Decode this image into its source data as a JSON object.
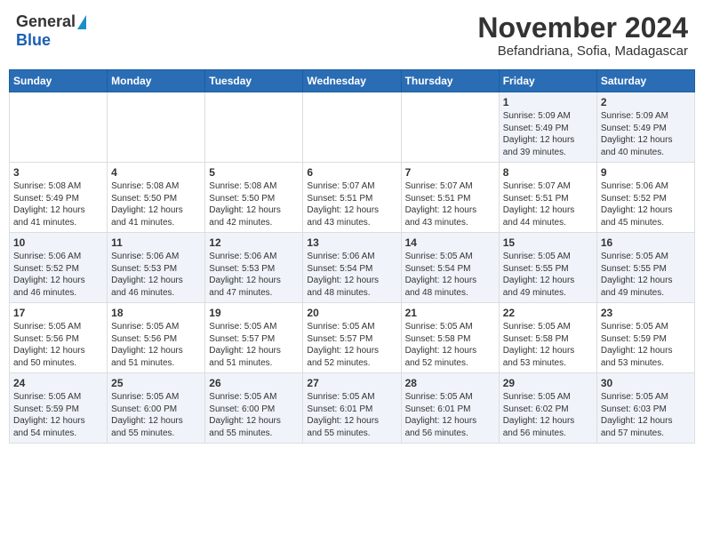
{
  "logo": {
    "general": "General",
    "blue": "Blue"
  },
  "title": "November 2024",
  "subtitle": "Befandriana, Sofia, Madagascar",
  "days": [
    "Sunday",
    "Monday",
    "Tuesday",
    "Wednesday",
    "Thursday",
    "Friday",
    "Saturday"
  ],
  "weeks": [
    [
      {
        "date": "",
        "info": ""
      },
      {
        "date": "",
        "info": ""
      },
      {
        "date": "",
        "info": ""
      },
      {
        "date": "",
        "info": ""
      },
      {
        "date": "",
        "info": ""
      },
      {
        "date": "1",
        "info": "Sunrise: 5:09 AM\nSunset: 5:49 PM\nDaylight: 12 hours\nand 39 minutes."
      },
      {
        "date": "2",
        "info": "Sunrise: 5:09 AM\nSunset: 5:49 PM\nDaylight: 12 hours\nand 40 minutes."
      }
    ],
    [
      {
        "date": "3",
        "info": "Sunrise: 5:08 AM\nSunset: 5:49 PM\nDaylight: 12 hours\nand 41 minutes."
      },
      {
        "date": "4",
        "info": "Sunrise: 5:08 AM\nSunset: 5:50 PM\nDaylight: 12 hours\nand 41 minutes."
      },
      {
        "date": "5",
        "info": "Sunrise: 5:08 AM\nSunset: 5:50 PM\nDaylight: 12 hours\nand 42 minutes."
      },
      {
        "date": "6",
        "info": "Sunrise: 5:07 AM\nSunset: 5:51 PM\nDaylight: 12 hours\nand 43 minutes."
      },
      {
        "date": "7",
        "info": "Sunrise: 5:07 AM\nSunset: 5:51 PM\nDaylight: 12 hours\nand 43 minutes."
      },
      {
        "date": "8",
        "info": "Sunrise: 5:07 AM\nSunset: 5:51 PM\nDaylight: 12 hours\nand 44 minutes."
      },
      {
        "date": "9",
        "info": "Sunrise: 5:06 AM\nSunset: 5:52 PM\nDaylight: 12 hours\nand 45 minutes."
      }
    ],
    [
      {
        "date": "10",
        "info": "Sunrise: 5:06 AM\nSunset: 5:52 PM\nDaylight: 12 hours\nand 46 minutes."
      },
      {
        "date": "11",
        "info": "Sunrise: 5:06 AM\nSunset: 5:53 PM\nDaylight: 12 hours\nand 46 minutes."
      },
      {
        "date": "12",
        "info": "Sunrise: 5:06 AM\nSunset: 5:53 PM\nDaylight: 12 hours\nand 47 minutes."
      },
      {
        "date": "13",
        "info": "Sunrise: 5:06 AM\nSunset: 5:54 PM\nDaylight: 12 hours\nand 48 minutes."
      },
      {
        "date": "14",
        "info": "Sunrise: 5:05 AM\nSunset: 5:54 PM\nDaylight: 12 hours\nand 48 minutes."
      },
      {
        "date": "15",
        "info": "Sunrise: 5:05 AM\nSunset: 5:55 PM\nDaylight: 12 hours\nand 49 minutes."
      },
      {
        "date": "16",
        "info": "Sunrise: 5:05 AM\nSunset: 5:55 PM\nDaylight: 12 hours\nand 49 minutes."
      }
    ],
    [
      {
        "date": "17",
        "info": "Sunrise: 5:05 AM\nSunset: 5:56 PM\nDaylight: 12 hours\nand 50 minutes."
      },
      {
        "date": "18",
        "info": "Sunrise: 5:05 AM\nSunset: 5:56 PM\nDaylight: 12 hours\nand 51 minutes."
      },
      {
        "date": "19",
        "info": "Sunrise: 5:05 AM\nSunset: 5:57 PM\nDaylight: 12 hours\nand 51 minutes."
      },
      {
        "date": "20",
        "info": "Sunrise: 5:05 AM\nSunset: 5:57 PM\nDaylight: 12 hours\nand 52 minutes."
      },
      {
        "date": "21",
        "info": "Sunrise: 5:05 AM\nSunset: 5:58 PM\nDaylight: 12 hours\nand 52 minutes."
      },
      {
        "date": "22",
        "info": "Sunrise: 5:05 AM\nSunset: 5:58 PM\nDaylight: 12 hours\nand 53 minutes."
      },
      {
        "date": "23",
        "info": "Sunrise: 5:05 AM\nSunset: 5:59 PM\nDaylight: 12 hours\nand 53 minutes."
      }
    ],
    [
      {
        "date": "24",
        "info": "Sunrise: 5:05 AM\nSunset: 5:59 PM\nDaylight: 12 hours\nand 54 minutes."
      },
      {
        "date": "25",
        "info": "Sunrise: 5:05 AM\nSunset: 6:00 PM\nDaylight: 12 hours\nand 55 minutes."
      },
      {
        "date": "26",
        "info": "Sunrise: 5:05 AM\nSunset: 6:00 PM\nDaylight: 12 hours\nand 55 minutes."
      },
      {
        "date": "27",
        "info": "Sunrise: 5:05 AM\nSunset: 6:01 PM\nDaylight: 12 hours\nand 55 minutes."
      },
      {
        "date": "28",
        "info": "Sunrise: 5:05 AM\nSunset: 6:01 PM\nDaylight: 12 hours\nand 56 minutes."
      },
      {
        "date": "29",
        "info": "Sunrise: 5:05 AM\nSunset: 6:02 PM\nDaylight: 12 hours\nand 56 minutes."
      },
      {
        "date": "30",
        "info": "Sunrise: 5:05 AM\nSunset: 6:03 PM\nDaylight: 12 hours\nand 57 minutes."
      }
    ]
  ]
}
